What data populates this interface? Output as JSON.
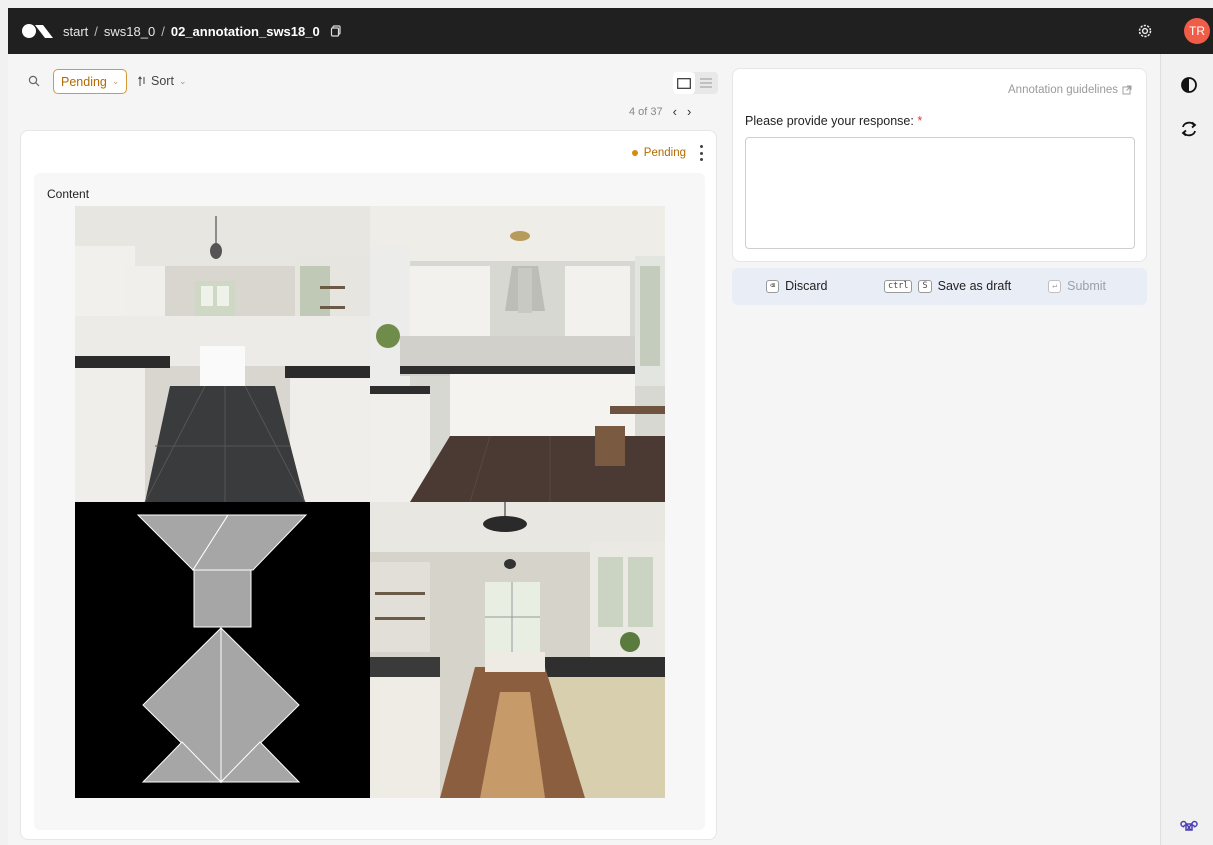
{
  "breadcrumb": {
    "items": [
      "start",
      "sws18_0",
      "02_annotation_sws18_0"
    ],
    "separator": "/"
  },
  "user": {
    "initials": "TR",
    "avatar_color": "#ef5c48"
  },
  "toolbar": {
    "status_filter": "Pending",
    "sort_label": "Sort"
  },
  "pager": {
    "text": "4 of 37"
  },
  "record": {
    "status": "Pending",
    "field_label": "Content"
  },
  "form": {
    "guidelines_link": "Annotation guidelines",
    "question": "Please provide your response:",
    "required_mark": "*",
    "response_value": ""
  },
  "actions": {
    "discard_label": "Discard",
    "save_draft_key1": "ctrl",
    "save_draft_key2": "S",
    "save_draft_label": "Save as draft",
    "submit_label": "Submit"
  },
  "icons": {
    "logo": "argilla-logo-icon",
    "copy": "copy-icon",
    "settings": "gear-icon",
    "search": "search-icon",
    "sort": "sort-icon",
    "guidelines": "external-link-icon",
    "theme": "contrast-icon",
    "refresh": "refresh-icon",
    "shortcuts": "command-icon"
  },
  "colors": {
    "topbar": "#202020",
    "pending": "#b36b00",
    "accent_shortcut": "#4a3fb5"
  }
}
